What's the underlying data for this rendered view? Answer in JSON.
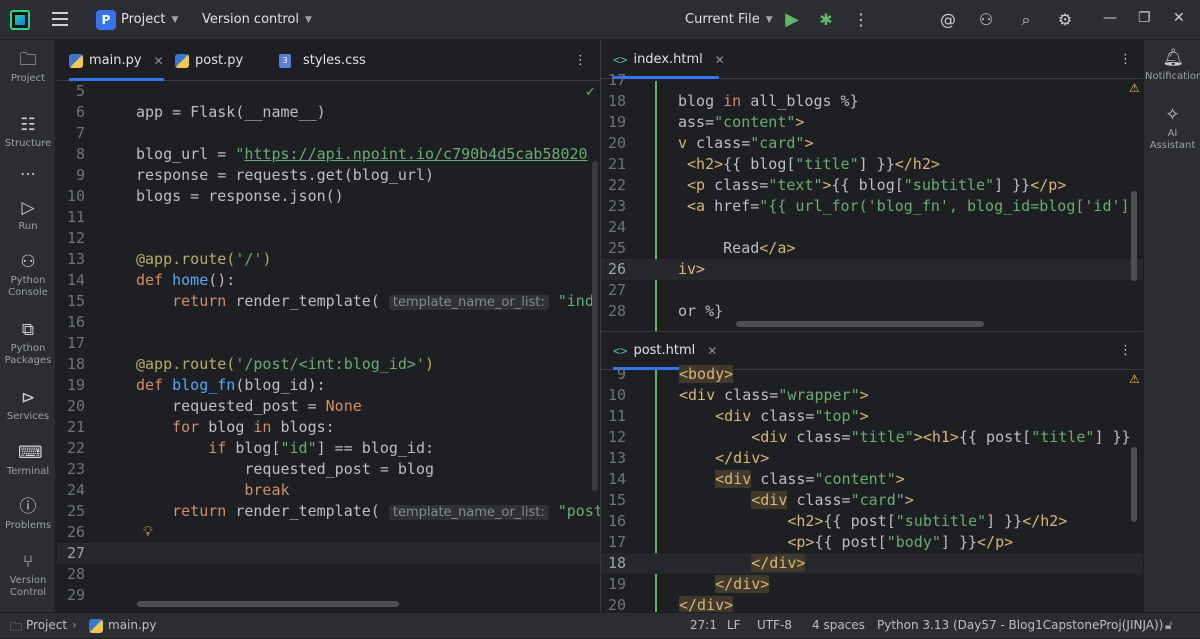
{
  "titlebar": {
    "project_badge": "P",
    "project_label": "Project",
    "vcs_label": "Version control",
    "run_config": "Current File"
  },
  "left_tools": [
    {
      "label": "Project",
      "icon": "folder-icon"
    },
    {
      "label": "Structure",
      "icon": "structure-icon"
    },
    {
      "label": "Run",
      "icon": "run-icon"
    },
    {
      "label": "Python Console",
      "icon": "python-console-icon"
    },
    {
      "label": "Python Packages",
      "icon": "python-packages-icon"
    },
    {
      "label": "Services",
      "icon": "services-icon"
    },
    {
      "label": "Terminal",
      "icon": "terminal-icon"
    },
    {
      "label": "Problems",
      "icon": "problems-icon"
    },
    {
      "label": "Version Control",
      "icon": "git-icon"
    }
  ],
  "right_tools": [
    {
      "label": "Notifications",
      "icon": "bell-icon"
    },
    {
      "label": "AI Assistant",
      "icon": "ai-assistant-icon"
    }
  ],
  "left_editor": {
    "tabs": [
      "main.py",
      "post.py",
      "styles.css"
    ],
    "active_tab": "main.py"
  },
  "top_right_editor": {
    "tab": "index.html"
  },
  "bottom_right_editor": {
    "tab": "post.html"
  },
  "statusbar": {
    "breadcrumb_project": "Project",
    "breadcrumb_file": "main.py",
    "position": "27:1",
    "line_sep": "LF",
    "encoding": "UTF-8",
    "indent": "4 spaces",
    "interpreter": "Python 3.13 (Day57 - Blog1CapstoneProj(JINJA))"
  },
  "colors": {
    "accent": "#3574f0",
    "background": "#1e1f22",
    "panel": "#2b2d30"
  }
}
